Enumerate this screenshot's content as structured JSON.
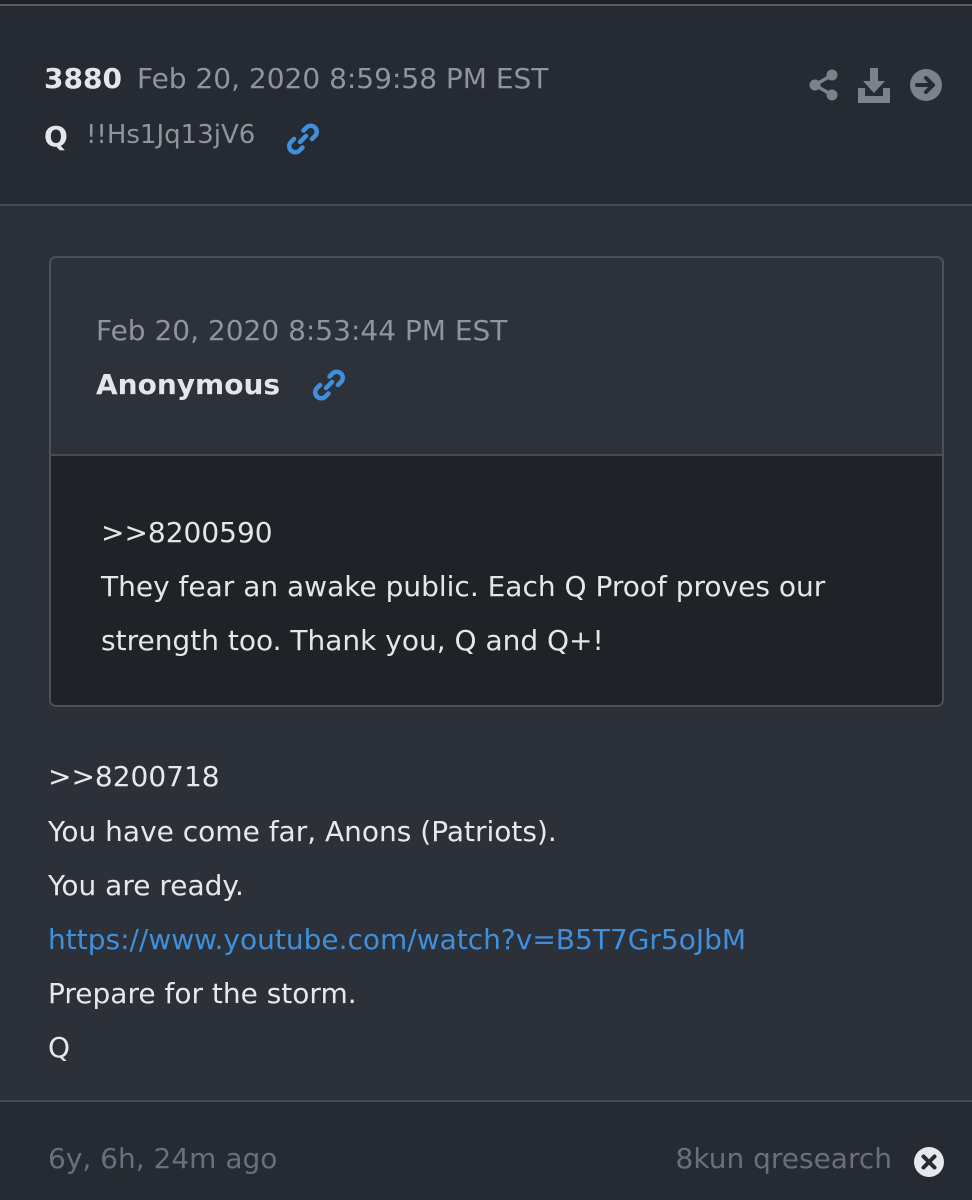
{
  "header": {
    "post_number": "3880",
    "timestamp": "Feb 20, 2020 8:59:58 PM EST",
    "author": "Q",
    "tripcode": "!!Hs1Jq13jV6",
    "icons": [
      "link-icon",
      "share-icon",
      "download-icon",
      "arrow-right-icon"
    ]
  },
  "quoted_post": {
    "timestamp": "Feb 20, 2020 8:53:44 PM EST",
    "author": "Anonymous",
    "lines": [
      ">>8200590",
      "They fear an awake public. Each Q Proof proves our",
      "strength too. Thank you, Q and Q+!"
    ]
  },
  "post_body": {
    "reply_ref": ">>8200718",
    "line1": "You have come far, Anons (Patriots).",
    "line2": "You are ready.",
    "link": "https://www.youtube.com/watch?v=B5T7Gr5oJbM",
    "line3": "Prepare for the storm.",
    "signature": "Q"
  },
  "footer": {
    "age": "6y, 6h, 24m ago",
    "source": "8kun qresearch",
    "icons": [
      "close-icon"
    ]
  },
  "colors": {
    "background": "#2c3039",
    "header_background": "#262a32",
    "quote_body_background": "#1f2227",
    "link": "#3f8fdb",
    "muted_text": "#8f949d",
    "text": "#e6e8ec"
  }
}
